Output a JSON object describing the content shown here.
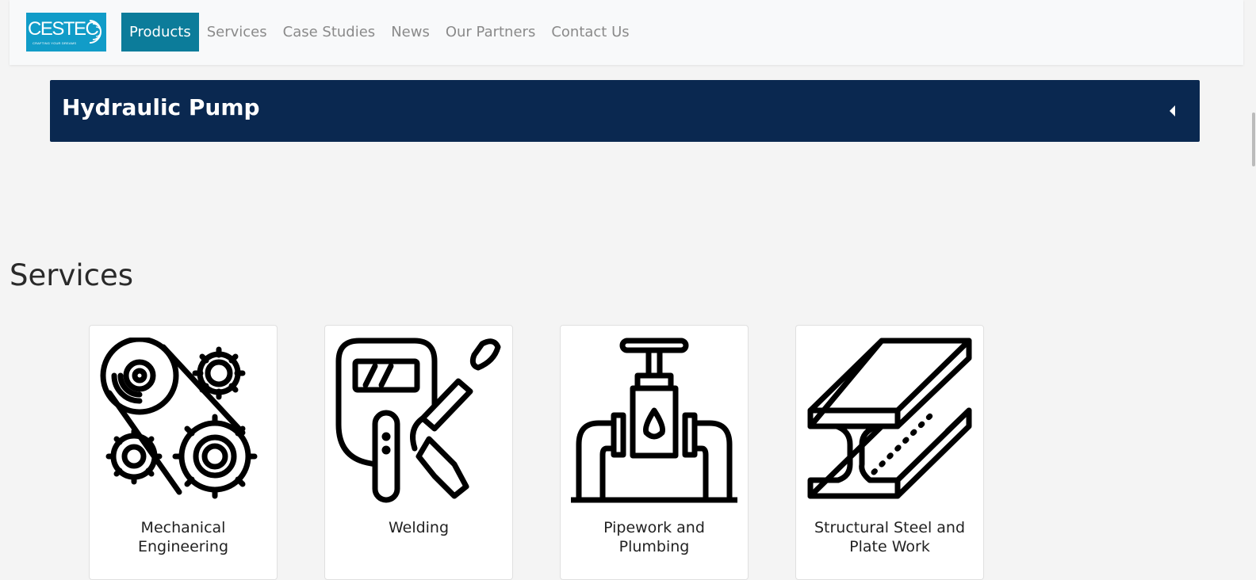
{
  "logo": {
    "text": "CESTEC",
    "tagline": "CRAFTING YOUR DREAMS"
  },
  "nav": {
    "items": [
      "Products",
      "Services",
      "Case Studies",
      "News",
      "Our Partners",
      "Contact Us"
    ],
    "active": "Products"
  },
  "accordion": {
    "title": "Hydraulic Pump"
  },
  "services": {
    "title": "Services",
    "cards": [
      {
        "label": "Mechanical Engineering",
        "icon": "gears-belt-icon"
      },
      {
        "label": "Welding",
        "icon": "welding-mask-torch-icon"
      },
      {
        "label": "Pipework and Plumbing",
        "icon": "pipe-valve-icon"
      },
      {
        "label": "Structural Steel and Plate Work",
        "icon": "steel-beam-icon"
      }
    ]
  },
  "colors": {
    "nav_active": "#0c7c9a",
    "accordion_bg": "#0a2850",
    "logo_bg": "#119cc8",
    "page_bg": "#f4f4f4"
  }
}
